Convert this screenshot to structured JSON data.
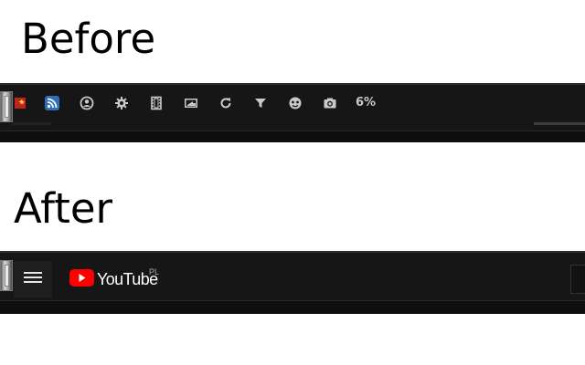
{
  "before": {
    "heading": "Before",
    "toolbar_icons": [
      "extension-icon",
      "rss-feed-icon",
      "account-circle-icon",
      "gear-icon",
      "film-strip-icon",
      "picture-in-picture-icon",
      "loop-icon",
      "filter-icon",
      "theater-masks-icon",
      "camera-icon"
    ],
    "percent_text": "6%"
  },
  "after": {
    "heading": "After",
    "logo_text": "YouTube",
    "country_code": "PL"
  },
  "colors": {
    "bar_background": "#161616",
    "youtube_red": "#ff0000",
    "icon_color": "#c9c9c9",
    "rss_blue": "#2e6fb7"
  }
}
